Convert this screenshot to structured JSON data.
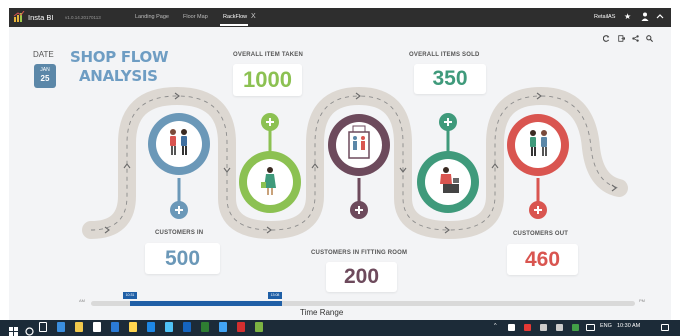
{
  "window": {
    "app_name": "Insta BI",
    "version": "v1.0.14.20170113",
    "tabs": [
      {
        "label": "Landing Page",
        "active": false
      },
      {
        "label": "Floor Map",
        "active": false
      },
      {
        "label": "RackFlow",
        "active": true
      }
    ],
    "close_glyph": "X",
    "account": "RetailAS",
    "title_icons": [
      "star-icon",
      "user-icon",
      "chevron-up-icon"
    ],
    "toolbar_icons": [
      "refresh-icon",
      "export-icon",
      "share-icon",
      "search-icon"
    ]
  },
  "dashboard": {
    "date_label": "DATE",
    "date_month": "JAN",
    "date_day": "25",
    "title_line1": "SHOP FLOW",
    "title_line2": "ANALYSIS",
    "kpis": {
      "overall_item_taken": {
        "label": "OVERALL ITEM TAKEN",
        "value": "1000",
        "color": "#8cc152"
      },
      "overall_items_sold": {
        "label": "OVERALL ITEMS SOLD",
        "value": "350",
        "color": "#3f9a7b"
      },
      "customers_in": {
        "label": "CUSTOMERS IN",
        "value": "500",
        "color": "#5b87a8"
      },
      "customers_in_fitting_room": {
        "label": "CUSTOMERS IN FITTING ROOM",
        "value": "200",
        "color": "#6d4a5c"
      },
      "customers_out": {
        "label": "CUSTOMERS OUT",
        "value": "460",
        "color": "#d95550"
      }
    },
    "stages": [
      {
        "name": "customers-in",
        "color": "#6b98b8",
        "icon": "couple-icon"
      },
      {
        "name": "item-taken",
        "color": "#8cc152",
        "icon": "shopper-icon"
      },
      {
        "name": "fitting-room",
        "color": "#6d4a5c",
        "icon": "fitting-room-icon"
      },
      {
        "name": "items-sold",
        "color": "#3f9a7b",
        "icon": "cashier-icon"
      },
      {
        "name": "customers-out",
        "color": "#d95550",
        "icon": "couple-icon"
      }
    ]
  },
  "time_range": {
    "label": "Time Range",
    "start_label": "AM",
    "end_label": "PM",
    "handle_start": "10:31",
    "handle_end": "13:08"
  },
  "taskbar": {
    "lang": "ENG",
    "time": "10:30 AM"
  }
}
